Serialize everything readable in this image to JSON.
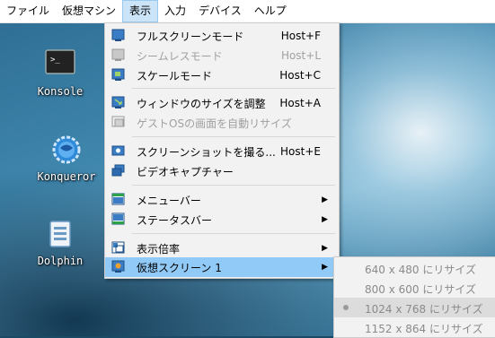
{
  "menubar": {
    "items": [
      {
        "label": "ファイル"
      },
      {
        "label": "仮想マシン"
      },
      {
        "label": "表示"
      },
      {
        "label": "入力"
      },
      {
        "label": "デバイス"
      },
      {
        "label": "ヘルプ"
      }
    ]
  },
  "desktop": {
    "icons": [
      {
        "label": "Konsole",
        "icon": "terminal-icon"
      },
      {
        "label": "Konqueror",
        "icon": "globe-gear-icon"
      },
      {
        "label": "Dolphin",
        "icon": "folder-icon"
      }
    ]
  },
  "view_menu": {
    "items": [
      {
        "label": "フルスクリーンモード",
        "shortcut": "Host+F",
        "icon": "fullscreen-icon"
      },
      {
        "label": "シームレスモード",
        "shortcut": "Host+L",
        "icon": "seamless-icon"
      },
      {
        "label": "スケールモード",
        "shortcut": "Host+C",
        "icon": "scale-icon"
      },
      {
        "label": "ウィンドウのサイズを調整",
        "shortcut": "Host+A",
        "icon": "adjust-window-icon"
      },
      {
        "label": "ゲストOSの画面を自動リサイズ",
        "icon": "auto-resize-icon"
      },
      {
        "label": "スクリーンショットを撮る...",
        "shortcut": "Host+E",
        "icon": "screenshot-icon"
      },
      {
        "label": "ビデオキャプチャー",
        "icon": "video-capture-icon"
      },
      {
        "label": "メニューバー",
        "icon": "menubar-icon"
      },
      {
        "label": "ステータスバー",
        "icon": "statusbar-icon"
      },
      {
        "label": "表示倍率",
        "icon": "scale-factor-icon"
      },
      {
        "label": "仮想スクリーン 1",
        "icon": "virtual-screen-icon"
      }
    ]
  },
  "screen_submenu": {
    "items": [
      {
        "label": "640 x 480 にリサイズ"
      },
      {
        "label": "800 x 600 にリサイズ"
      },
      {
        "label": "1024 x 768 にリサイズ"
      },
      {
        "label": "1152 x 864 にリサイズ"
      }
    ]
  },
  "colors": {
    "highlight": "#91c9f7",
    "menubar_active": "#cce4f7",
    "disabled_text": "#a0a0a0"
  }
}
